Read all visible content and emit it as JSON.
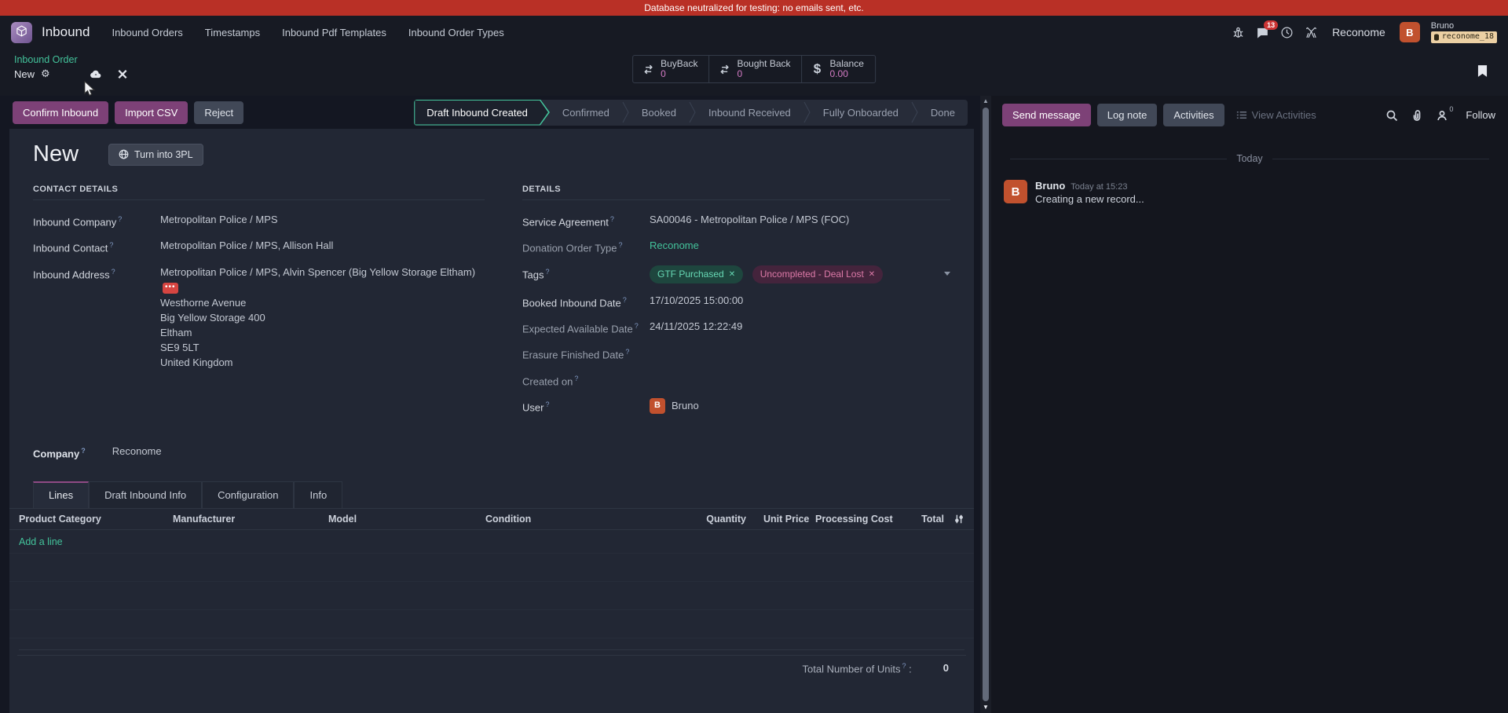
{
  "ui": {
    "help": "?",
    "close": "✕",
    "dots": "•••",
    "gear": "⚙",
    "up_arrow": "▲",
    "down_arrow": "▼"
  },
  "banner": {
    "text": "Database neutralized for testing: no emails sent, etc."
  },
  "navbar": {
    "app_name": "Inbound",
    "menus": [
      "Inbound Orders",
      "Timestamps",
      "Inbound Pdf Templates",
      "Inbound Order Types"
    ],
    "message_count": "13",
    "company": "Reconome",
    "user_name": "Bruno",
    "user_badge": "reconome_18",
    "avatar_initial": "B"
  },
  "breadcrumb": {
    "parent": "Inbound Order",
    "current": "New"
  },
  "stats": [
    {
      "label": "BuyBack",
      "value": "0"
    },
    {
      "label": "Bought Back",
      "value": "0"
    },
    {
      "label": "Balance",
      "value": "0.00"
    }
  ],
  "actions": {
    "confirm": "Confirm Inbound",
    "import_csv": "Import CSV",
    "reject": "Reject"
  },
  "statusbar": {
    "active": "Draft Inbound Created",
    "steps": [
      "Confirmed",
      "Booked",
      "Inbound Received",
      "Fully Onboarded",
      "Done"
    ]
  },
  "form": {
    "title": "New",
    "action_3pl": "Turn into 3PL",
    "contact": {
      "section_title": "CONTACT DETAILS",
      "company_label": "Inbound Company",
      "company_value": "Metropolitan Police / MPS",
      "contact_label": "Inbound Contact",
      "contact_value": "Metropolitan Police / MPS, Allison Hall",
      "address_label": "Inbound Address",
      "address_value": "Metropolitan Police / MPS, Alvin Spencer (Big Yellow Storage Eltham)",
      "address_lines": [
        "Westhorne Avenue",
        "Big Yellow Storage 400",
        "Eltham",
        "SE9 5LT",
        "United Kingdom"
      ]
    },
    "details": {
      "section_title": "DETAILS",
      "service_agreement_label": "Service Agreement",
      "service_agreement_value": "SA00046 - Metropolitan Police / MPS (FOC)",
      "donation_type_label": "Donation Order Type",
      "donation_type_value": "Reconome",
      "tags_label": "Tags",
      "tags": [
        {
          "text": "GTF Purchased"
        },
        {
          "text": "Uncompleted - Deal Lost"
        }
      ],
      "booked_label": "Booked Inbound Date",
      "booked_value": "17/10/2025 15:00:00",
      "expected_label": "Expected Available Date",
      "expected_value": "24/11/2025 12:22:49",
      "erasure_label": "Erasure Finished Date",
      "created_label": "Created on",
      "user_label": "User",
      "user_value": "Bruno",
      "user_initial": "B"
    },
    "company_label": "Company",
    "company_value": "Reconome",
    "tabs": [
      "Lines",
      "Draft Inbound Info",
      "Configuration",
      "Info"
    ],
    "table": {
      "headers": [
        "Product Category",
        "Manufacturer",
        "Model",
        "Condition",
        "Quantity",
        "Unit Price",
        "Processing Cost",
        "Total"
      ],
      "add_line": "Add a line",
      "total_label": "Total Number of Units",
      "total_value": "0"
    }
  },
  "chatter": {
    "send_message": "Send message",
    "log_note": "Log note",
    "activities": "Activities",
    "view_activities": "View Activities",
    "follow": "Follow",
    "follower_count": "0",
    "day": "Today",
    "message": {
      "author": "Bruno",
      "time": "Today at 15:23",
      "body": "Creating a new record...",
      "initial": "B"
    }
  },
  "colors": {
    "accent_teal": "#43c39b",
    "primary_purple": "#7d4177",
    "banner_red": "#b93026",
    "value_pink": "#d47cc5"
  }
}
